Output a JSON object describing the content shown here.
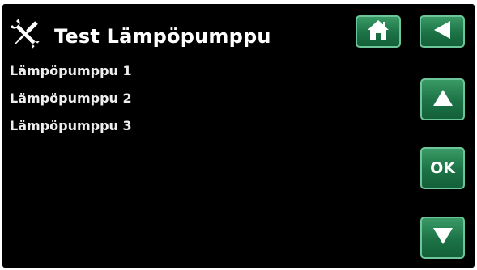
{
  "header": {
    "title": "Test Lämpöpumppu",
    "icon": "tools-icon"
  },
  "nav_buttons": {
    "home_icon": "home-icon",
    "back_icon": "back-arrow-icon",
    "up_icon": "up-arrow-icon",
    "ok_label": "OK",
    "down_icon": "down-arrow-icon"
  },
  "menu": {
    "items": [
      {
        "label": "Lämpöpumppu 1"
      },
      {
        "label": "Lämpöpumppu 2"
      },
      {
        "label": "Lämpöpumppu 3"
      }
    ]
  },
  "colors": {
    "background": "#000000",
    "button_green": "#1c7246",
    "button_border": "#6cc69a",
    "text": "#ffffff"
  }
}
